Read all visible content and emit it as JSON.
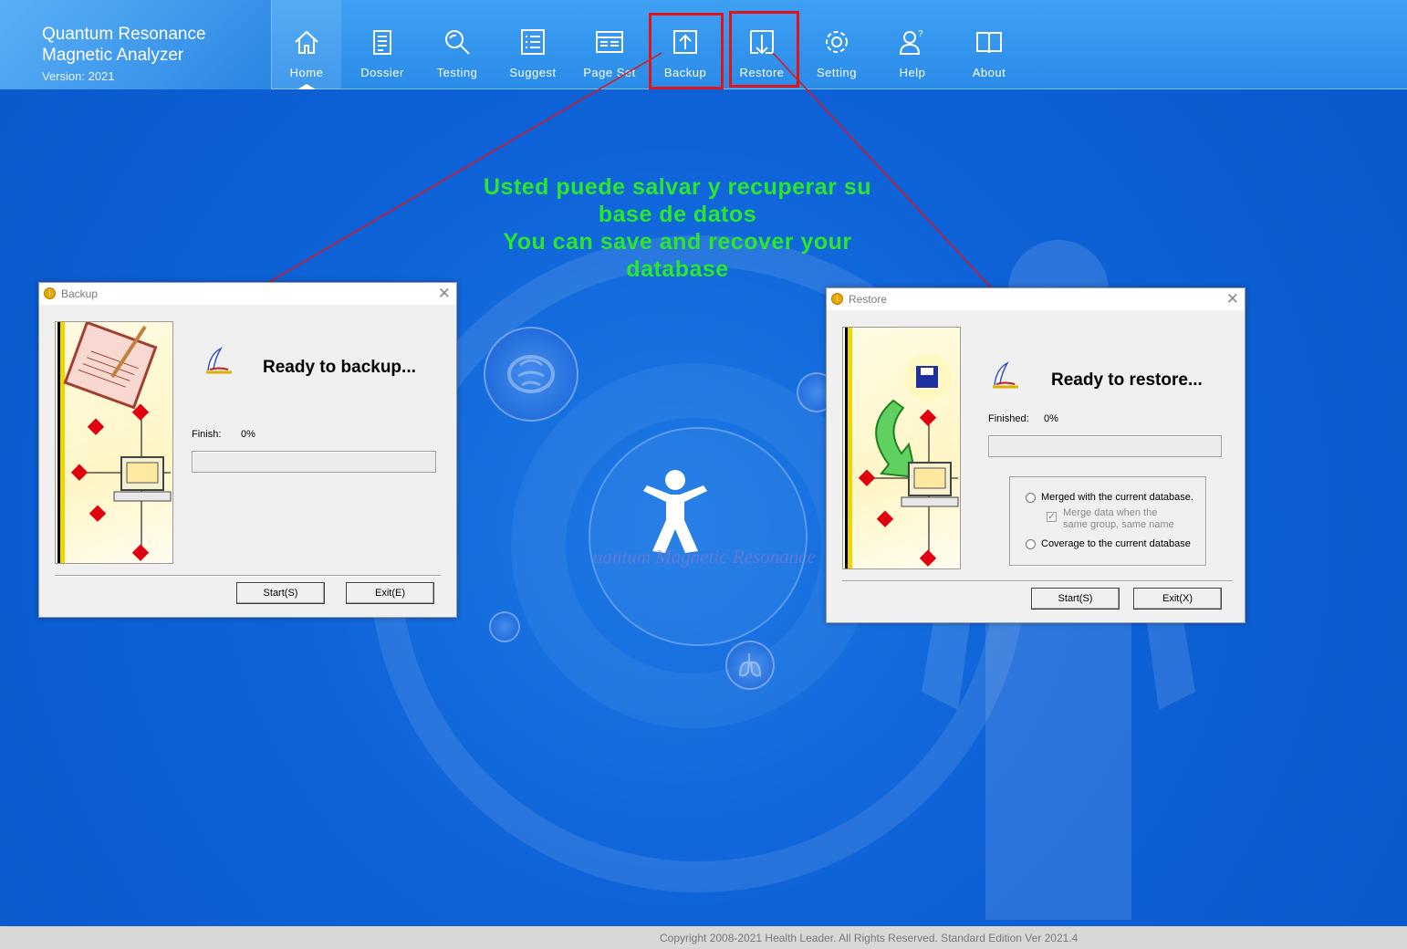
{
  "app": {
    "title_line1": "Quantum Resonance",
    "title_line2": "Magnetic Analyzer",
    "version": "Version: 2021"
  },
  "nav": {
    "items": [
      {
        "label": "Home",
        "icon": "home-icon"
      },
      {
        "label": "Dossier",
        "icon": "dossier-icon"
      },
      {
        "label": "Testing",
        "icon": "testing-icon"
      },
      {
        "label": "Suggest",
        "icon": "suggest-icon"
      },
      {
        "label": "Page Set",
        "icon": "page-set-icon"
      },
      {
        "label": "Backup",
        "icon": "backup-icon"
      },
      {
        "label": "Restore",
        "icon": "restore-icon"
      },
      {
        "label": "Setting",
        "icon": "gear-icon"
      },
      {
        "label": "Help",
        "icon": "help-icon"
      },
      {
        "label": "About",
        "icon": "book-icon"
      }
    ],
    "active": "Home",
    "highlighted": [
      "Backup",
      "Restore"
    ]
  },
  "annotation": {
    "line1": "Usted puede salvar y recuperar su",
    "line2": "base de datos",
    "line3": "You can save and recover your",
    "line4": "database",
    "color": "#2be62b",
    "highlight_color": "#e0141a"
  },
  "center_logo": "uantum Magnetic Resonance",
  "backup_dialog": {
    "title": "Backup",
    "status": "Ready to backup...",
    "finish_label": "Finish:",
    "finish_value": "0%",
    "progress": 0,
    "start_button": "Start(S)",
    "exit_button": "Exit(E)"
  },
  "restore_dialog": {
    "title": "Restore",
    "status": "Ready to restore...",
    "finished_label": "Finished:",
    "finished_value": "0%",
    "progress": 0,
    "option_merge": "Merged with the current database.",
    "option_merge_sub_line1": "Merge data when the",
    "option_merge_sub_line2": "same group, same name",
    "option_coverage": "Coverage to the current database",
    "start_button": "Start(S)",
    "exit_button": "Exit(X)"
  },
  "footer": {
    "text": "Copyright 2008-2021 Health Leader. All Rights Reserved.  Standard Edition Ver 2021.4"
  }
}
